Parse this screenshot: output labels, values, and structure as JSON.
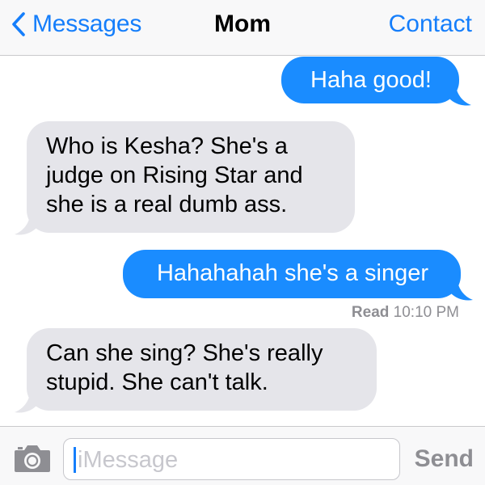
{
  "navbar": {
    "back_label": "Messages",
    "title": "Mom",
    "contact_label": "Contact",
    "accent_color": "#157efb"
  },
  "messages": [
    {
      "direction": "outgoing",
      "text": "Haha good!"
    },
    {
      "direction": "incoming",
      "lines": [
        "Who is Kesha?  She's a",
        "judge on Rising Star and",
        "she is a real dumb ass."
      ]
    },
    {
      "direction": "outgoing",
      "text": "Hahahahah she's a singer"
    },
    {
      "direction": "incoming",
      "lines": [
        "Can she sing?  She's really",
        "stupid. She can't talk."
      ]
    }
  ],
  "read_receipt": {
    "label": "Read",
    "time": "10:10 PM"
  },
  "input": {
    "placeholder": "iMessage",
    "send_label": "Send",
    "camera_icon": "camera-icon"
  },
  "colors": {
    "outgoing_bubble": "#1a8cff",
    "incoming_bubble": "#e5e5ea",
    "secondary_text": "#8e8e93"
  }
}
